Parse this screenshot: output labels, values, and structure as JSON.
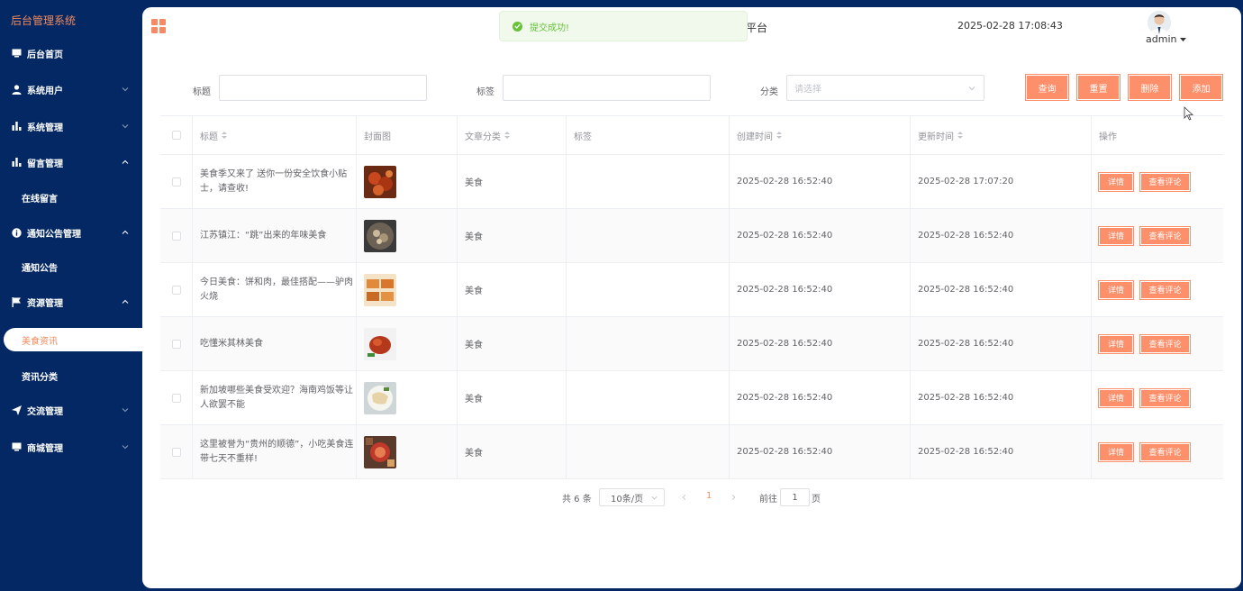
{
  "sidebar": {
    "brand": "后台管理系统",
    "items": [
      {
        "label": "后台首页",
        "icon": "monitor-icon"
      },
      {
        "label": "系统用户",
        "icon": "user-icon"
      },
      {
        "label": "系统管理",
        "icon": "bar-chart-icon"
      },
      {
        "label": "留言管理",
        "icon": "bar-chart-icon"
      },
      {
        "label": "在线留言"
      },
      {
        "label": "通知公告管理",
        "icon": "info-icon"
      },
      {
        "label": "通知公告"
      },
      {
        "label": "资源管理",
        "icon": "flag-icon"
      },
      {
        "label": "美食资讯"
      },
      {
        "label": "资讯分类"
      },
      {
        "label": "交流管理",
        "icon": "send-icon"
      },
      {
        "label": "商城管理",
        "icon": "monitor-icon"
      }
    ]
  },
  "header": {
    "title": "平台",
    "time": "2025-02-28 17:08:43",
    "user": "admin"
  },
  "toast": {
    "message": "提交成功!"
  },
  "filters": {
    "title_label": "标题",
    "tag_label": "标签",
    "category_label": "分类",
    "category_placeholder": "请选择",
    "buttons": [
      "查询",
      "重置",
      "删除",
      "添加"
    ]
  },
  "table": {
    "headers": [
      "标题",
      "封面图",
      "文章分类",
      "标签",
      "创建时间",
      "更新时间",
      "操作"
    ],
    "ops": [
      "详情",
      "查看评论"
    ],
    "rows": [
      {
        "title": "美食季又来了 送你一份安全饮食小贴士，请查收!",
        "category": "美食",
        "tag": "",
        "created": "2025-02-28 16:52:40",
        "updated": "2025-02-28 17:07:20"
      },
      {
        "title": "江苏镇江：“跳”出来的年味美食",
        "category": "美食",
        "tag": "",
        "created": "2025-02-28 16:52:40",
        "updated": "2025-02-28 16:52:40"
      },
      {
        "title": "今日美食：饼和肉，最佳搭配——驴肉火烧",
        "category": "美食",
        "tag": "",
        "created": "2025-02-28 16:52:40",
        "updated": "2025-02-28 16:52:40"
      },
      {
        "title": "吃懂米其林美食",
        "category": "美食",
        "tag": "",
        "created": "2025-02-28 16:52:40",
        "updated": "2025-02-28 16:52:40"
      },
      {
        "title": "新加坡哪些美食受欢迎？海南鸡饭等让人欲罢不能",
        "category": "美食",
        "tag": "",
        "created": "2025-02-28 16:52:40",
        "updated": "2025-02-28 16:52:40"
      },
      {
        "title": "这里被誉为“贵州的顺德”，小吃美食连带七天不重样!",
        "category": "美食",
        "tag": "",
        "created": "2025-02-28 16:52:40",
        "updated": "2025-02-28 16:52:40"
      }
    ]
  },
  "pagination": {
    "total": "共 6 条",
    "page_size": "10条/页",
    "current": "1",
    "goto_label": "前往",
    "goto_value": "1",
    "page_suffix": "页"
  },
  "colors": {
    "accent": "#fd8f6a",
    "sidebar": "#042863",
    "success": "#67c23a"
  }
}
